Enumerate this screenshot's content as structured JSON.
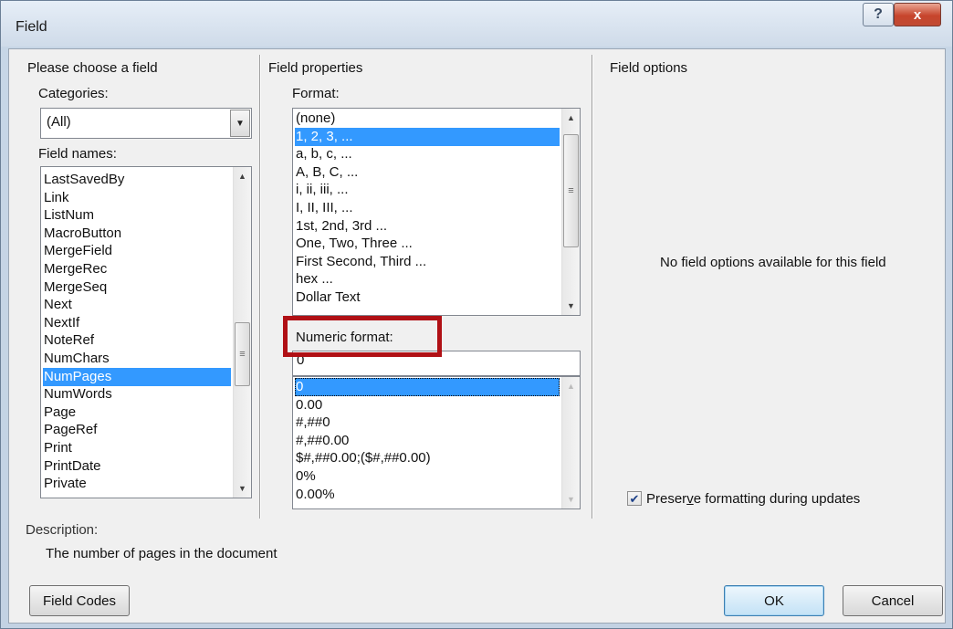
{
  "window": {
    "title": "Field",
    "help_label": "?",
    "close_label": "x"
  },
  "left": {
    "group_title": "Please choose a field",
    "categories_label": "Categories:",
    "categories_value": "(All)",
    "field_names_label": "Field names:",
    "field_names": [
      "LastSavedBy",
      "Link",
      "ListNum",
      "MacroButton",
      "MergeField",
      "MergeRec",
      "MergeSeq",
      "Next",
      "NextIf",
      "NoteRef",
      "NumChars",
      "NumPages",
      "NumWords",
      "Page",
      "PageRef",
      "Print",
      "PrintDate",
      "Private"
    ],
    "selected_field": "NumPages"
  },
  "middle": {
    "group_title": "Field properties",
    "format_label": "Format:",
    "formats": [
      "(none)",
      "1, 2, 3, ...",
      "a, b, c, ...",
      "A, B, C, ...",
      "i, ii, iii, ...",
      "I, II, III, ...",
      "1st, 2nd, 3rd ...",
      "One, Two, Three ...",
      "First Second, Third ...",
      "hex ...",
      "Dollar Text"
    ],
    "selected_format": "1, 2, 3, ...",
    "numeric_format_label": "Numeric format:",
    "numeric_format_value": "0",
    "numeric_formats": [
      "0",
      "0.00",
      "#,##0",
      "#,##0.00",
      "$#,##0.00;($#,##0.00)",
      "0%",
      "0.00%"
    ],
    "selected_numeric_format": "0"
  },
  "right": {
    "group_title": "Field options",
    "no_options_text": "No field options available for this field",
    "preserve_label": "Preserve formatting during updates",
    "preserve_checked": true
  },
  "description": {
    "label": "Description:",
    "text": "The number of pages in the document"
  },
  "buttons": {
    "field_codes": "Field Codes",
    "ok": "OK",
    "cancel": "Cancel"
  },
  "colors": {
    "selection": "#3399ff",
    "highlight_box": "#b01015"
  }
}
